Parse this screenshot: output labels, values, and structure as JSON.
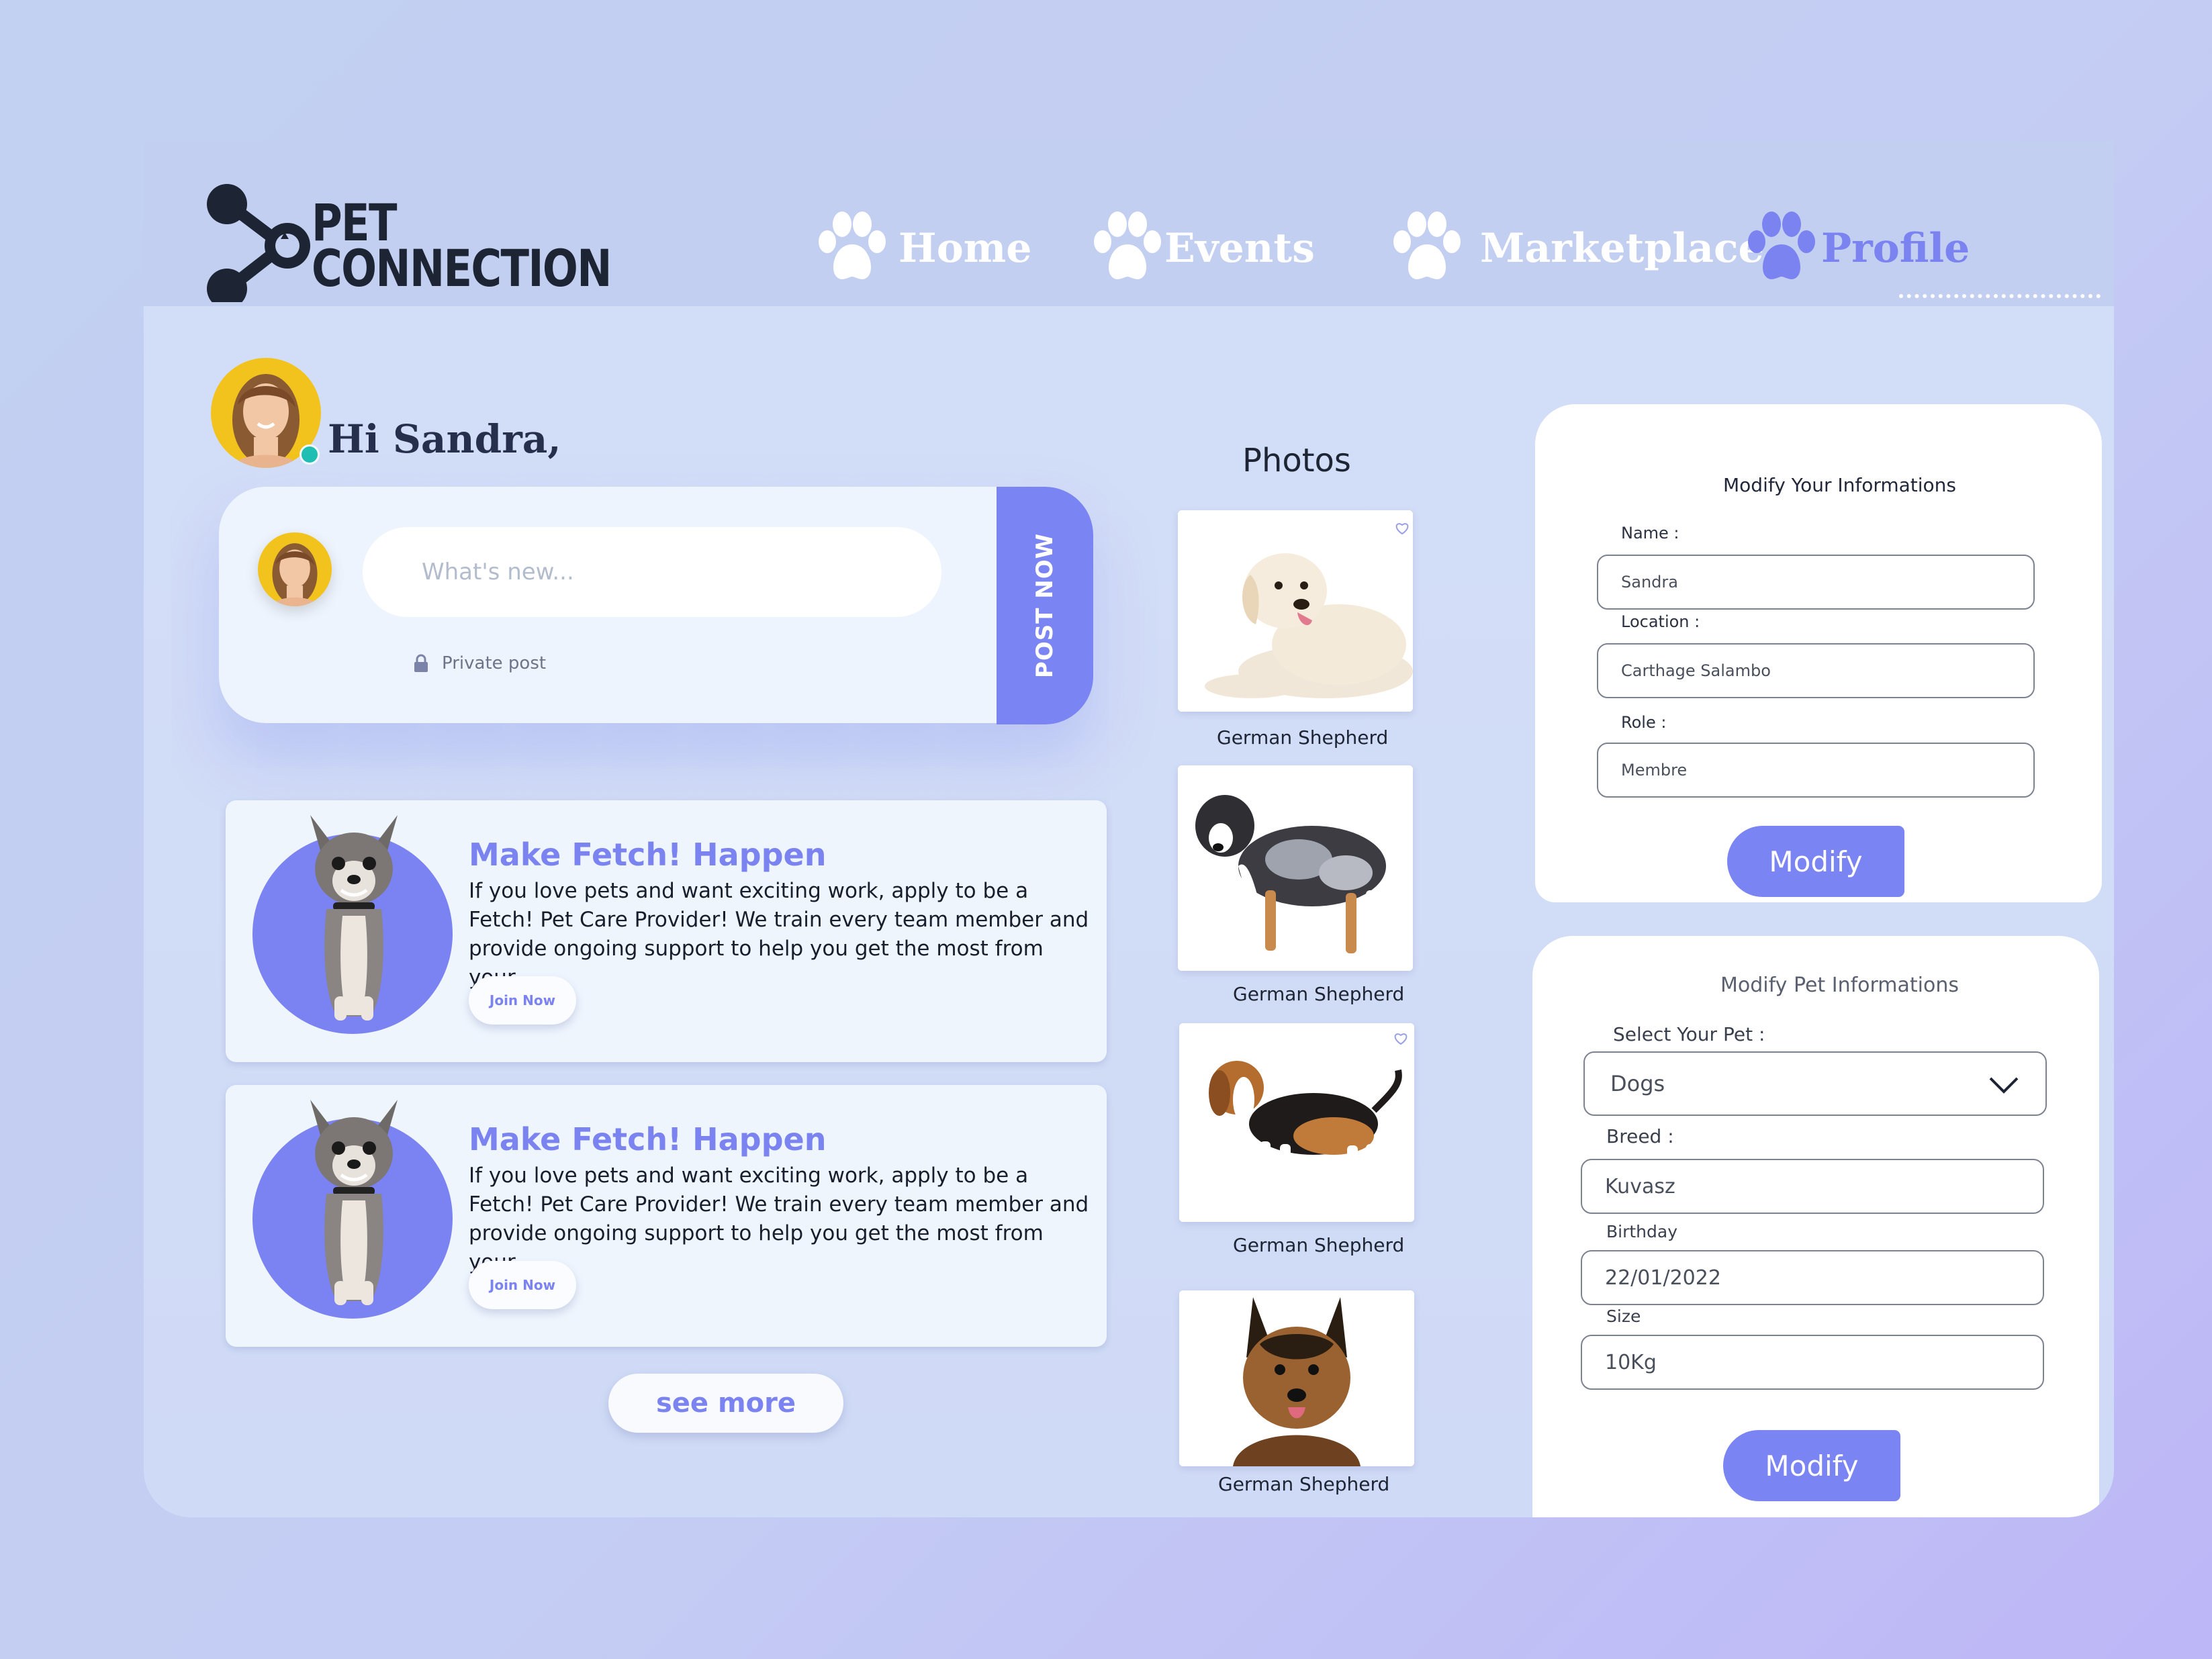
{
  "brand": {
    "line1": "PET",
    "line2": "CONNECTION"
  },
  "nav": [
    {
      "label": "Home",
      "active": false
    },
    {
      "label": "Events",
      "active": false
    },
    {
      "label": "Marketplace",
      "active": false
    },
    {
      "label": "Profile",
      "active": true
    }
  ],
  "greeting": "Hi Sandra,",
  "post": {
    "placeholder": "What's new...",
    "privacy": "Private post",
    "button": "POST NOW"
  },
  "cards": [
    {
      "title": "Make Fetch! Happen",
      "description": "If you love pets and want exciting work, apply to be a Fetch! Pet Care Provider! We train every team member and provide ongoing support to help you get the most from your",
      "button": "Join Now"
    },
    {
      "title": "Make Fetch! Happen",
      "description": "If you love pets and want exciting work, apply to be a Fetch! Pet Care Provider! We train every team member and provide ongoing support to help you get the most from your",
      "button": "Join Now"
    }
  ],
  "see_more": "see more",
  "photos": {
    "title": "Photos",
    "items": [
      {
        "caption": "German Shepherd"
      },
      {
        "caption": "German Shepherd"
      },
      {
        "caption": "German Shepherd"
      },
      {
        "caption": "German Shepherd"
      }
    ]
  },
  "user_form": {
    "title": "Modify Your Informations",
    "name_label": "Name :",
    "name_value": "Sandra",
    "location_label": "Location :",
    "location_value": "Carthage Salambo",
    "role_label": "Role :",
    "role_value": "Membre",
    "button": "Modify"
  },
  "pet_form": {
    "title": "Modify Pet Informations",
    "pet_label": "Select Your Pet :",
    "pet_value": "Dogs",
    "breed_label": "Breed :",
    "breed_value": "Kuvasz",
    "birthday_label": "Birthday",
    "birthday_value": "22/01/2022",
    "size_label": "Size",
    "size_value": "10Kg",
    "button": "Modify"
  },
  "colors": {
    "accent": "#7a84f2",
    "online": "#20bfb4",
    "avatar_bg": "#f3c31d"
  }
}
